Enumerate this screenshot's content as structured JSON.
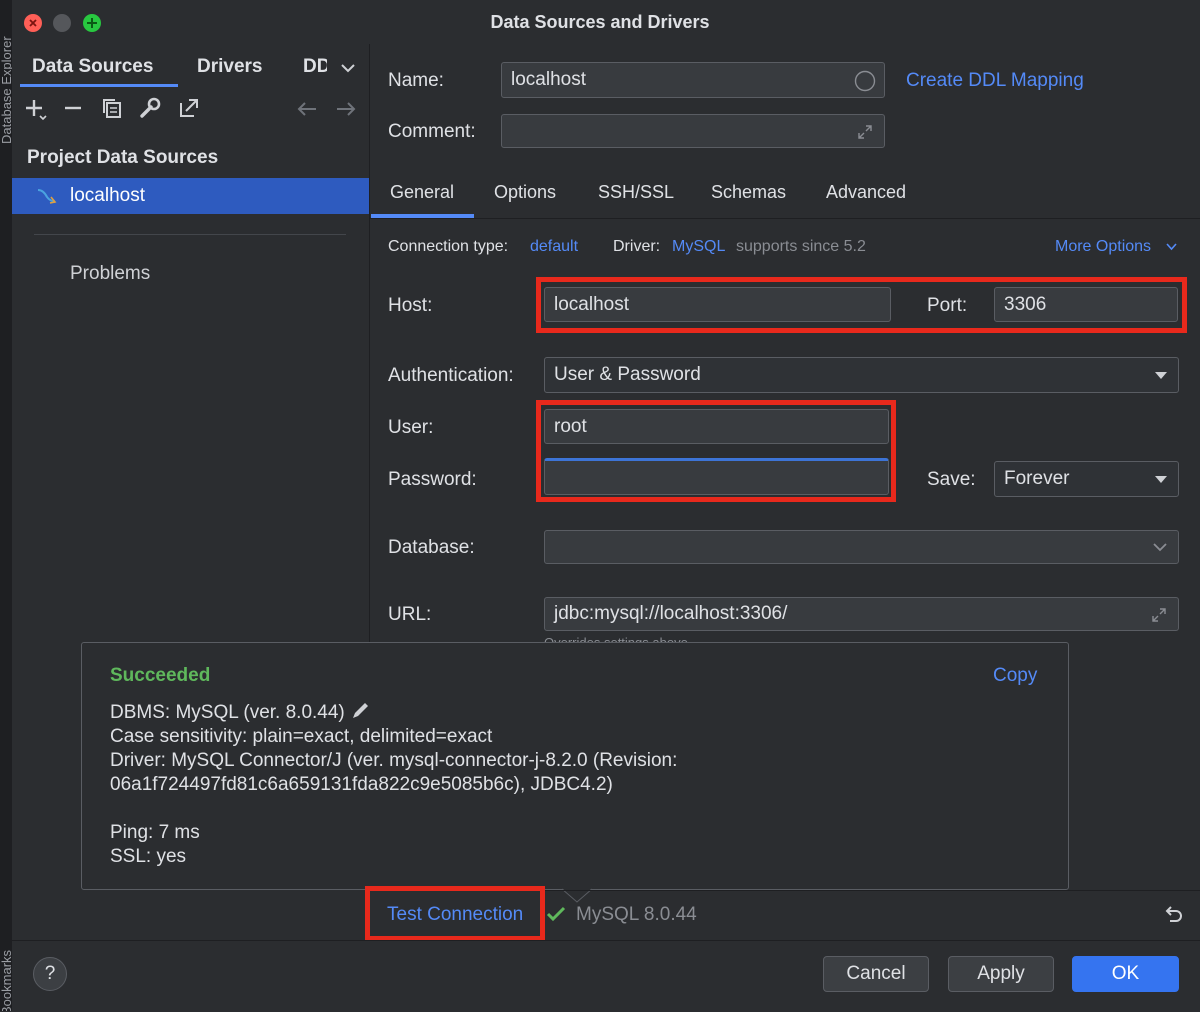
{
  "window": {
    "title": "Data Sources and Drivers"
  },
  "side_strip": {
    "top_text": "Database Explorer",
    "bottom_text": "Bookmarks"
  },
  "left_panel": {
    "tabs": [
      "Data Sources",
      "Drivers",
      "DD"
    ],
    "section_header": "Project Data Sources",
    "selected_item": "localhost",
    "problems": "Problems"
  },
  "form": {
    "name_label": "Name:",
    "name_value": "localhost",
    "create_ddl": "Create DDL Mapping",
    "comment_label": "Comment:",
    "comment_value": "",
    "tabs": [
      "General",
      "Options",
      "SSH/SSL",
      "Schemas",
      "Advanced"
    ],
    "connection_type_label": "Connection type:",
    "connection_type_value": "default",
    "driver_label": "Driver:",
    "driver_value": "MySQL",
    "driver_note": "supports since 5.2",
    "more_options": "More Options",
    "host_label": "Host:",
    "host_value": "localhost",
    "port_label": "Port:",
    "port_value": "3306",
    "auth_label": "Authentication:",
    "auth_value": "User & Password",
    "user_label": "User:",
    "user_value": "root",
    "password_label": "Password:",
    "password_value": "",
    "save_label": "Save:",
    "save_value": "Forever",
    "database_label": "Database:",
    "database_value": "",
    "url_label": "URL:",
    "url_value": "jdbc:mysql://localhost:3306/",
    "url_hint": "Overrides settings above"
  },
  "popup": {
    "status": "Succeeded",
    "copy": "Copy",
    "line1": "DBMS: MySQL (ver. 8.0.44)",
    "line2": "Case sensitivity: plain=exact, delimited=exact",
    "line3": "Driver: MySQL Connector/J (ver. mysql-connector-j-8.2.0 (Revision:",
    "line4": "06a1f724497fd81c6a659131fda822c9e5085b6c), JDBC4.2)",
    "line5": "Ping: 7 ms",
    "line6": "SSL: yes"
  },
  "test": {
    "label": "Test Connection",
    "result": "MySQL 8.0.44"
  },
  "footer": {
    "help": "?",
    "cancel": "Cancel",
    "apply": "Apply",
    "ok": "OK"
  },
  "colors": {
    "accent": "#548af7",
    "success": "#5fb85c",
    "highlight": "#e8291c",
    "selection": "#2e5bbf"
  }
}
